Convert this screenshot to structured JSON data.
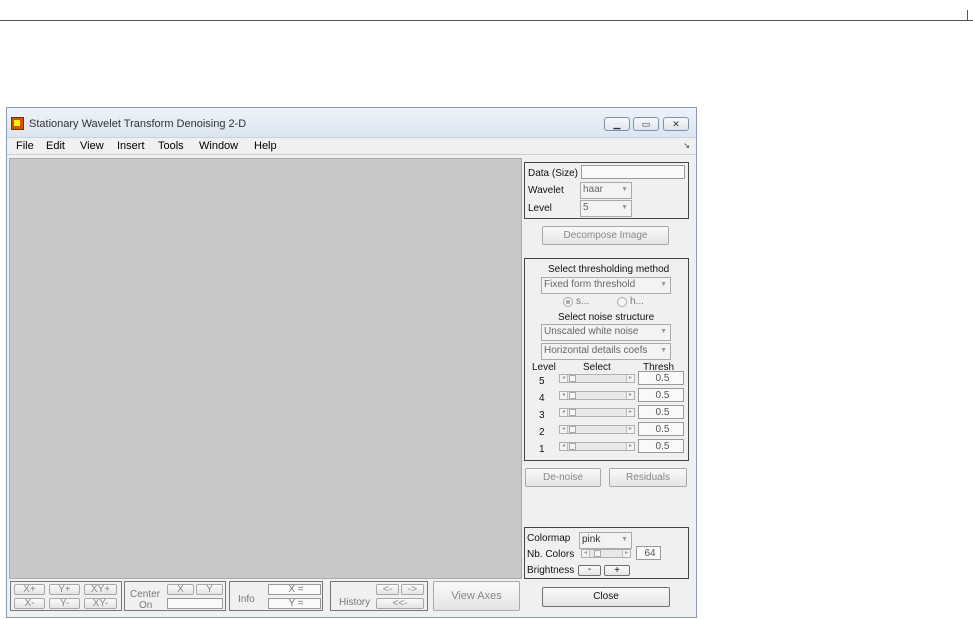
{
  "window": {
    "title": "Stationary Wavelet Transform Denoising 2-D"
  },
  "window_controls": {
    "minimize": "▁",
    "maximize": "▭",
    "close": "✕"
  },
  "menu": [
    "File",
    "Edit",
    "View",
    "Insert",
    "Tools",
    "Window",
    "Help"
  ],
  "data_panel": {
    "data_label": "Data  (Size)",
    "data_value": "",
    "wavelet_label": "Wavelet",
    "wavelet_value": "haar",
    "level_label": "Level",
    "level_value": "5"
  },
  "decompose_button": "Decompose Image",
  "threshold_panel": {
    "method_heading": "Select thresholding method",
    "method_value": "Fixed form threshold",
    "radio_soft": "s...",
    "radio_hard": "h...",
    "radio_selected": "soft",
    "noise_heading": "Select noise structure",
    "noise_value": "Unscaled white noise",
    "details_value": "Horizontal details coefs",
    "col_level": "Level",
    "col_select": "Select",
    "col_thresh": "Thresh",
    "rows": [
      {
        "level": "5",
        "thresh": "0.5"
      },
      {
        "level": "4",
        "thresh": "0.5"
      },
      {
        "level": "3",
        "thresh": "0.5"
      },
      {
        "level": "2",
        "thresh": "0.5"
      },
      {
        "level": "1",
        "thresh": "0.5"
      }
    ]
  },
  "denoise_button": "De-noise",
  "residuals_button": "Residuals",
  "color_panel": {
    "colormap_label": "Colormap",
    "colormap_value": "pink",
    "ncolors_label": "Nb. Colors",
    "ncolors_value": "64",
    "brightness_label": "Brightness",
    "minus": "-",
    "plus": "+"
  },
  "close_button": "Close",
  "toolbar": {
    "xplus": "X+",
    "yplus": "Y+",
    "xyplus": "XY+",
    "xminus": "X-",
    "yminus": "Y-",
    "xyminus": "XY-",
    "center_label": "Center",
    "on_label": "On",
    "x_btn": "X",
    "y_btn": "Y",
    "info_label": "Info",
    "x_eq": "X =",
    "y_eq": "Y =",
    "history_label": "History",
    "hist_back": "<-",
    "hist_fwd": "->",
    "hist_first": "<<-",
    "view_axes": "View Axes"
  },
  "colors": {
    "axes_bg": "#c8c8c8",
    "panel_bg": "#f0f0f0",
    "accent": "#d35400"
  }
}
